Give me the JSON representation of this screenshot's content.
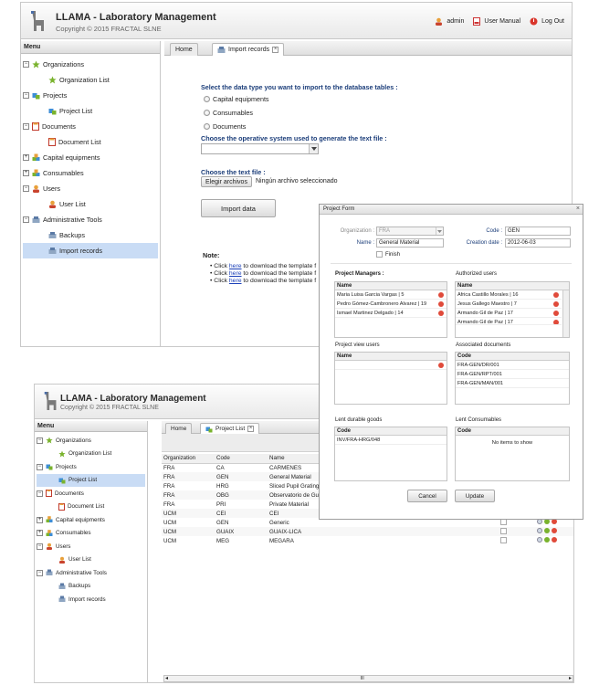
{
  "app": {
    "title": "LLAMA - Laboratory Management",
    "copyright": "Copyright © 2015 FRACTAL SLNE"
  },
  "topnav": {
    "user": "admin",
    "manual": "User Manual",
    "logout": "Log Out"
  },
  "menu": {
    "header": "Menu",
    "organizations": "Organizations",
    "organization_list": "Organization List",
    "projects": "Projects",
    "project_list": "Project List",
    "documents": "Documents",
    "document_list": "Document List",
    "capital_equipments": "Capital equipments",
    "consumables": "Consumables",
    "users": "Users",
    "user_list": "User List",
    "admin_tools": "Administrative Tools",
    "backups": "Backups",
    "import_records": "Import records"
  },
  "import_view": {
    "tabs": {
      "home": "Home",
      "import": "Import records"
    },
    "select_type_label": "Select the data type you want to import to the database tables :",
    "options": [
      "Capital equipments",
      "Consumables",
      "Documents"
    ],
    "os_label": "Choose the operative system used to generate the text file :",
    "file_label": "Choose the text file :",
    "file_button": "Elegir archivos",
    "file_none": "Ningún archivo seleccionado",
    "import_button": "Import data",
    "note_label": "Note:",
    "notes": [
      {
        "pre": "Click ",
        "link": "here",
        "post": " to download the template f"
      },
      {
        "pre": "Click ",
        "link": "here",
        "post": " to download the template f"
      },
      {
        "pre": "Click ",
        "link": "here",
        "post": " to download the template f"
      }
    ]
  },
  "project_form": {
    "title": "Project Form",
    "organization_label": "Organization :",
    "organization_value": "FRA",
    "code_label": "Code :",
    "code_value": "GEN",
    "name_label": "Name :",
    "name_value": "General Material",
    "creation_label": "Creation date :",
    "creation_value": "2012-06-03",
    "finish_label": "Finish",
    "managers_title": "Project Managers :",
    "managers_col": "Name",
    "managers": [
      "Maria Luisa Garcia Vargas | 5",
      "Pedro Gómez-Cambronero Alvarez | 19",
      "Ismael Martinez Delgado | 14"
    ],
    "authorized_title": "Authorized users",
    "authorized_col": "Name",
    "authorized": [
      "Africa Castillo Morales | 16",
      "Jesus Gallego Maestro | 7",
      "Armando Gil de Paz | 17",
      "Armando Gil de Paz | 17"
    ],
    "viewers_title": "Project view users",
    "viewers_col": "Name",
    "docs_title": "Associated documents",
    "docs_col": "Code",
    "docs": [
      "FRA-GEN/DR/001",
      "FRA-GEN/RPT/001",
      "FRA-GEN/MAN/001"
    ],
    "durable_title": "Lent durable goods",
    "durable_col": "Code",
    "durable": [
      "INV/FRA-HRG/048"
    ],
    "consumables_title": "Lent Consumables",
    "consumables_col": "Code",
    "consumables_empty": "No items to show",
    "cancel": "Cancel",
    "update": "Update"
  },
  "project_view": {
    "tabs": {
      "home": "Home",
      "list": "Project List"
    },
    "columns": [
      "Organization",
      "Code",
      "Name"
    ],
    "rows": [
      [
        "FRA",
        "CA",
        "CARMENES"
      ],
      [
        "FRA",
        "GEN",
        "General Material"
      ],
      [
        "FRA",
        "HRG",
        "Sliced Pupil Grating"
      ],
      [
        "FRA",
        "OBG",
        "Observatorio de Gua"
      ],
      [
        "FRA",
        "PRI",
        "Private Material"
      ],
      [
        "UCM",
        "CEI",
        "CEI"
      ],
      [
        "UCM",
        "GEN",
        "Generic"
      ],
      [
        "UCM",
        "GUAIX",
        "GUAIX-LICA"
      ],
      [
        "UCM",
        "MEG",
        "MEGARA"
      ]
    ],
    "scroll_mark": "III"
  },
  "colors": {
    "selection": "#c9dcf5",
    "link": "#1a3fb8",
    "delete": "#e04a3a",
    "panel_border": "#c8c8c8"
  }
}
